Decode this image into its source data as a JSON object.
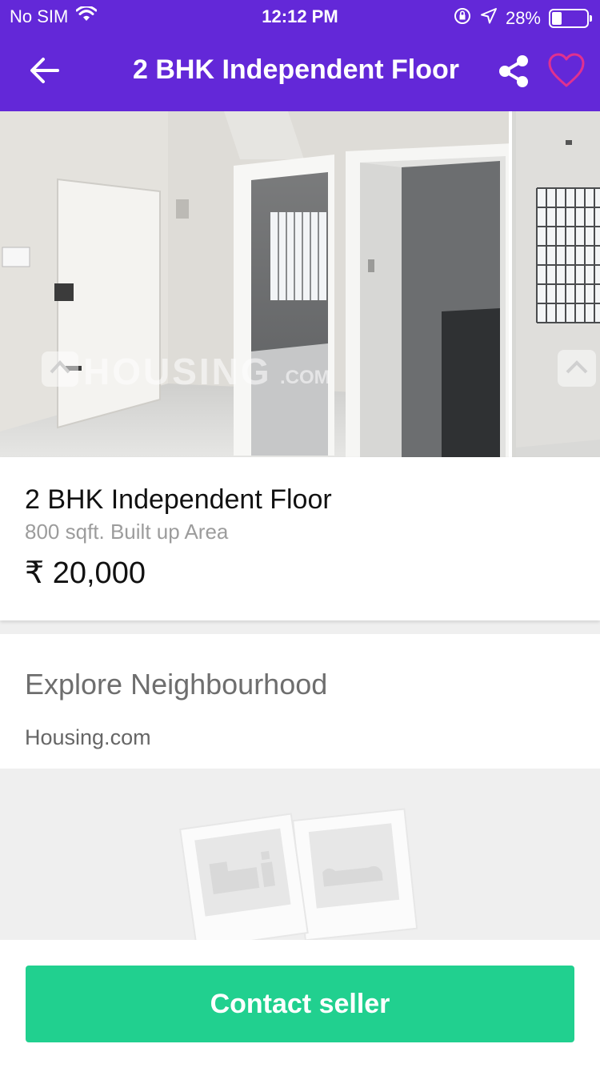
{
  "status_bar": {
    "carrier": "No SIM",
    "time": "12:12 PM",
    "battery_percent": "28%",
    "battery_level": 0.28,
    "icons": [
      "wifi-icon",
      "orientation-lock-icon",
      "location-arrow-icon",
      "battery-icon"
    ]
  },
  "navbar": {
    "title": "2 BHK Independent Floor",
    "back_icon": "arrow-left-icon",
    "share_icon": "share-icon",
    "favorite_icon": "heart-outline-icon",
    "bar_color": "#6328d8",
    "favorite_color": "#e0318f"
  },
  "gallery": {
    "watermark": "HOUSING",
    "watermark_suffix": ".COM"
  },
  "listing": {
    "title": "2 BHK Independent Floor",
    "area": "800 sqft. Built up Area",
    "price": "₹ 20,000"
  },
  "explore": {
    "title": "Explore Neighbourhood",
    "source": "Housing.com"
  },
  "footer": {
    "contact_label": "Contact seller",
    "button_color": "#21d08f"
  }
}
